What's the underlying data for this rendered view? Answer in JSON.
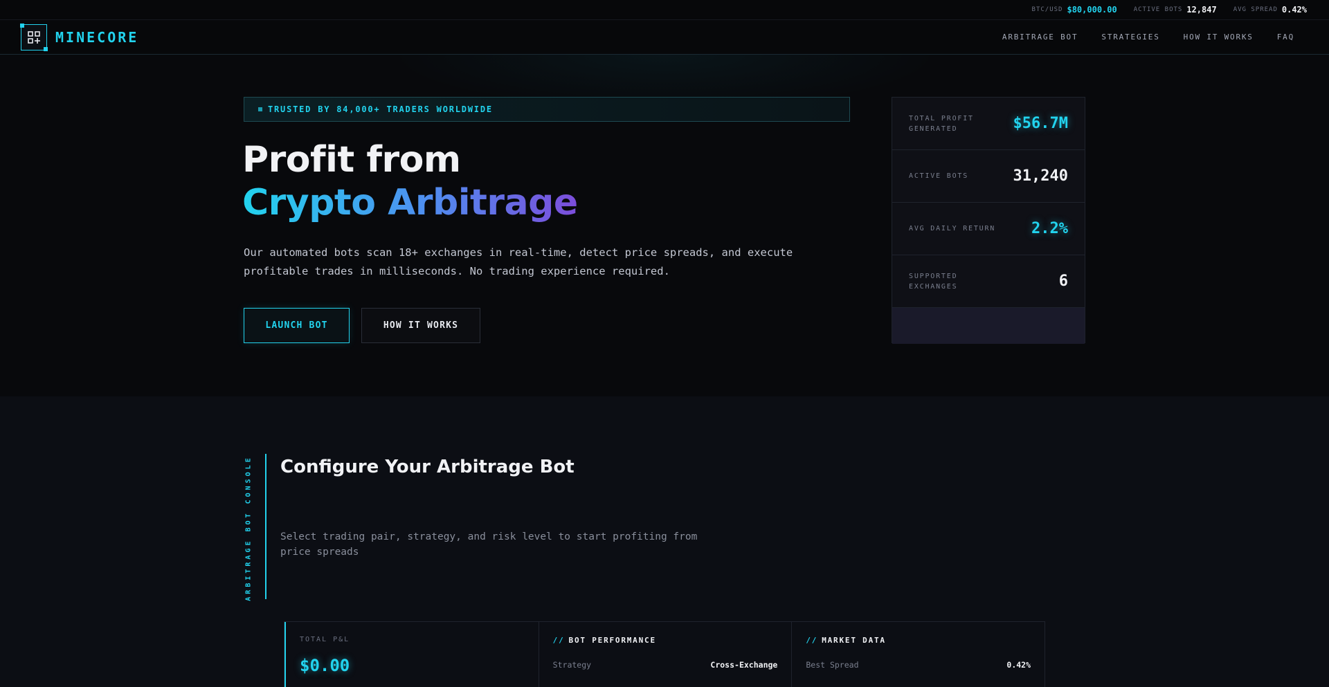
{
  "ticker": [
    {
      "label": "BTC/USD",
      "value": "$80,000.00",
      "accent": true
    },
    {
      "label": "ACTIVE BOTS",
      "value": "12,847",
      "accent": false
    },
    {
      "label": "AVG SPREAD",
      "value": "0.42%",
      "accent": false
    }
  ],
  "nav": {
    "brand": "MINECORE",
    "links": [
      "ARBITRAGE BOT",
      "STRATEGIES",
      "HOW IT WORKS",
      "FAQ"
    ]
  },
  "hero": {
    "badge": "TRUSTED BY 84,000+ TRADERS WORLDWIDE",
    "title_line1": "Profit from",
    "title_line2": "Crypto Arbitrage",
    "description": "Our automated bots scan 18+ exchanges in real-time, detect price spreads, and execute profitable trades in milliseconds. No trading experience required.",
    "primary_button": "LAUNCH BOT",
    "secondary_button": "HOW IT WORKS"
  },
  "stats": [
    {
      "label": "TOTAL PROFIT GENERATED",
      "value": "$56.7M",
      "accent": true
    },
    {
      "label": "ACTIVE BOTS",
      "value": "31,240",
      "accent": false
    },
    {
      "label": "AVG DAILY RETURN",
      "value": "2.2%",
      "accent": true
    },
    {
      "label": "SUPPORTED EXCHANGES",
      "value": "6",
      "accent": false
    }
  ],
  "config": {
    "side_label": "ARBITRAGE BOT CONSOLE",
    "title": "Configure Your Arbitrage Bot",
    "subtitle": "Select trading pair, strategy, and risk level to start profiting from price spreads"
  },
  "dashboard": {
    "pnl_label": "TOTAL P&L",
    "pnl_value": "$0.00",
    "performance": {
      "heading": "BOT PERFORMANCE",
      "slash": "//",
      "key": "Strategy",
      "value": "Cross-Exchange"
    },
    "market": {
      "heading": "MARKET DATA",
      "slash": "//",
      "key": "Best Spread",
      "value": "0.42%"
    }
  },
  "colors": {
    "accent": "#22d3ee",
    "gradient_end": "#7c4ddb",
    "background": "#08090c"
  },
  "icons": {
    "logo": "grid-plus-icon"
  }
}
